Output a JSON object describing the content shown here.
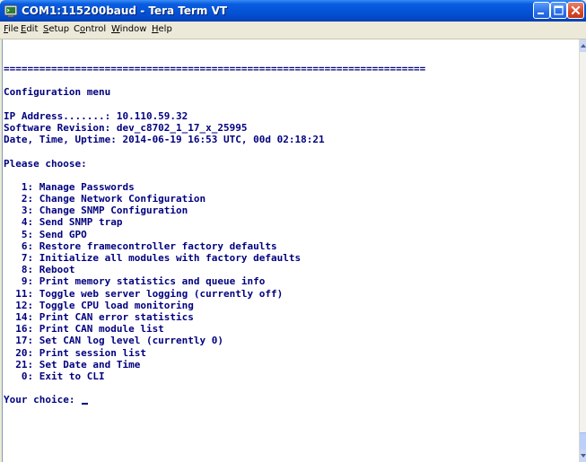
{
  "window": {
    "title": "COM1:115200baud - Tera Term VT"
  },
  "menu": {
    "items": [
      {
        "accel": "F",
        "rest": "ile"
      },
      {
        "accel": "E",
        "rest": "dit"
      },
      {
        "accel": "S",
        "rest": "etup"
      },
      {
        "accel": "",
        "pre": "C",
        "accel2": "o",
        "rest": "ntrol"
      },
      {
        "accel": "W",
        "rest": "indow"
      },
      {
        "accel": "H",
        "rest": "elp"
      }
    ]
  },
  "terminal": {
    "lines": [
      "=======================================================================",
      "",
      "Configuration menu",
      "",
      "IP Address.......: 10.110.59.32",
      "Software Revision: dev_c8702_1_17_x_25995",
      "Date, Time, Uptime: 2014-06-19 16:53 UTC, 00d 02:18:21",
      "",
      "Please choose:",
      "",
      "   1: Manage Passwords",
      "   2: Change Network Configuration",
      "   3: Change SNMP Configuration",
      "   4: Send SNMP trap",
      "   5: Send GPO",
      "   6: Restore framecontroller factory defaults",
      "   7: Initialize all modules with factory defaults",
      "   8: Reboot",
      "   9: Print memory statistics and queue info",
      "  11: Toggle web server logging (currently off)",
      "  12: Toggle CPU load monitoring",
      "  14: Print CAN error statistics",
      "  16: Print CAN module list",
      "  17: Set CAN log level (currently 0)",
      "  20: Print session list",
      "  21: Set Date and Time",
      "   0: Exit to CLI",
      "",
      "Your choice: "
    ]
  },
  "icons": {
    "app": "tera-term-icon",
    "minimize": "minimize-icon",
    "maximize": "maximize-icon",
    "close": "close-icon"
  },
  "colors": {
    "titlebar": "#0554d8",
    "terminal_text": "#00007f",
    "terminal_bg": "#ffffff",
    "close_button": "#d5472a"
  }
}
